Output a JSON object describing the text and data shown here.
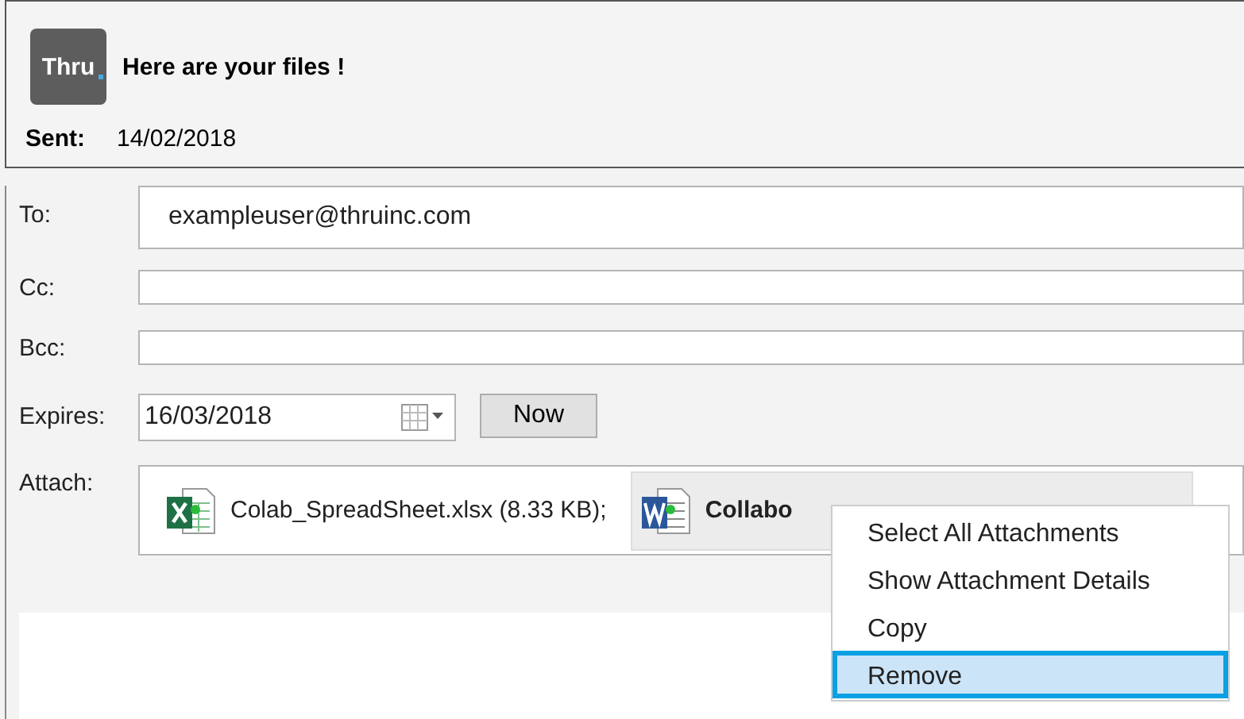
{
  "header": {
    "logo_text": "Thru",
    "subject": "Here are your files !",
    "sent_label": "Sent:",
    "sent_date": "14/02/2018"
  },
  "fields": [
    {
      "label": "To:",
      "value": "exampleuser@thruinc.com",
      "kind": "tall"
    },
    {
      "label": "Cc:",
      "kind": "line"
    },
    {
      "label": "Bcc:",
      "kind": "line"
    }
  ],
  "expires": {
    "label": "Expires:",
    "value": "16/03/2018",
    "button": "Now"
  },
  "attach": {
    "label": "Attach:",
    "items": [
      {
        "kind": "excel",
        "name": "Colab_SpreadSheet.xlsx (8.33 KB);",
        "selected": false
      },
      {
        "kind": "word",
        "name": "Collabo",
        "selected": true
      }
    ]
  },
  "context_menu": [
    {
      "label": "Select All Attachments",
      "selected": false
    },
    {
      "label": "Show Attachment Details",
      "selected": false
    },
    {
      "label": "Copy",
      "selected": false
    },
    {
      "label": "Remove",
      "selected": true
    }
  ]
}
